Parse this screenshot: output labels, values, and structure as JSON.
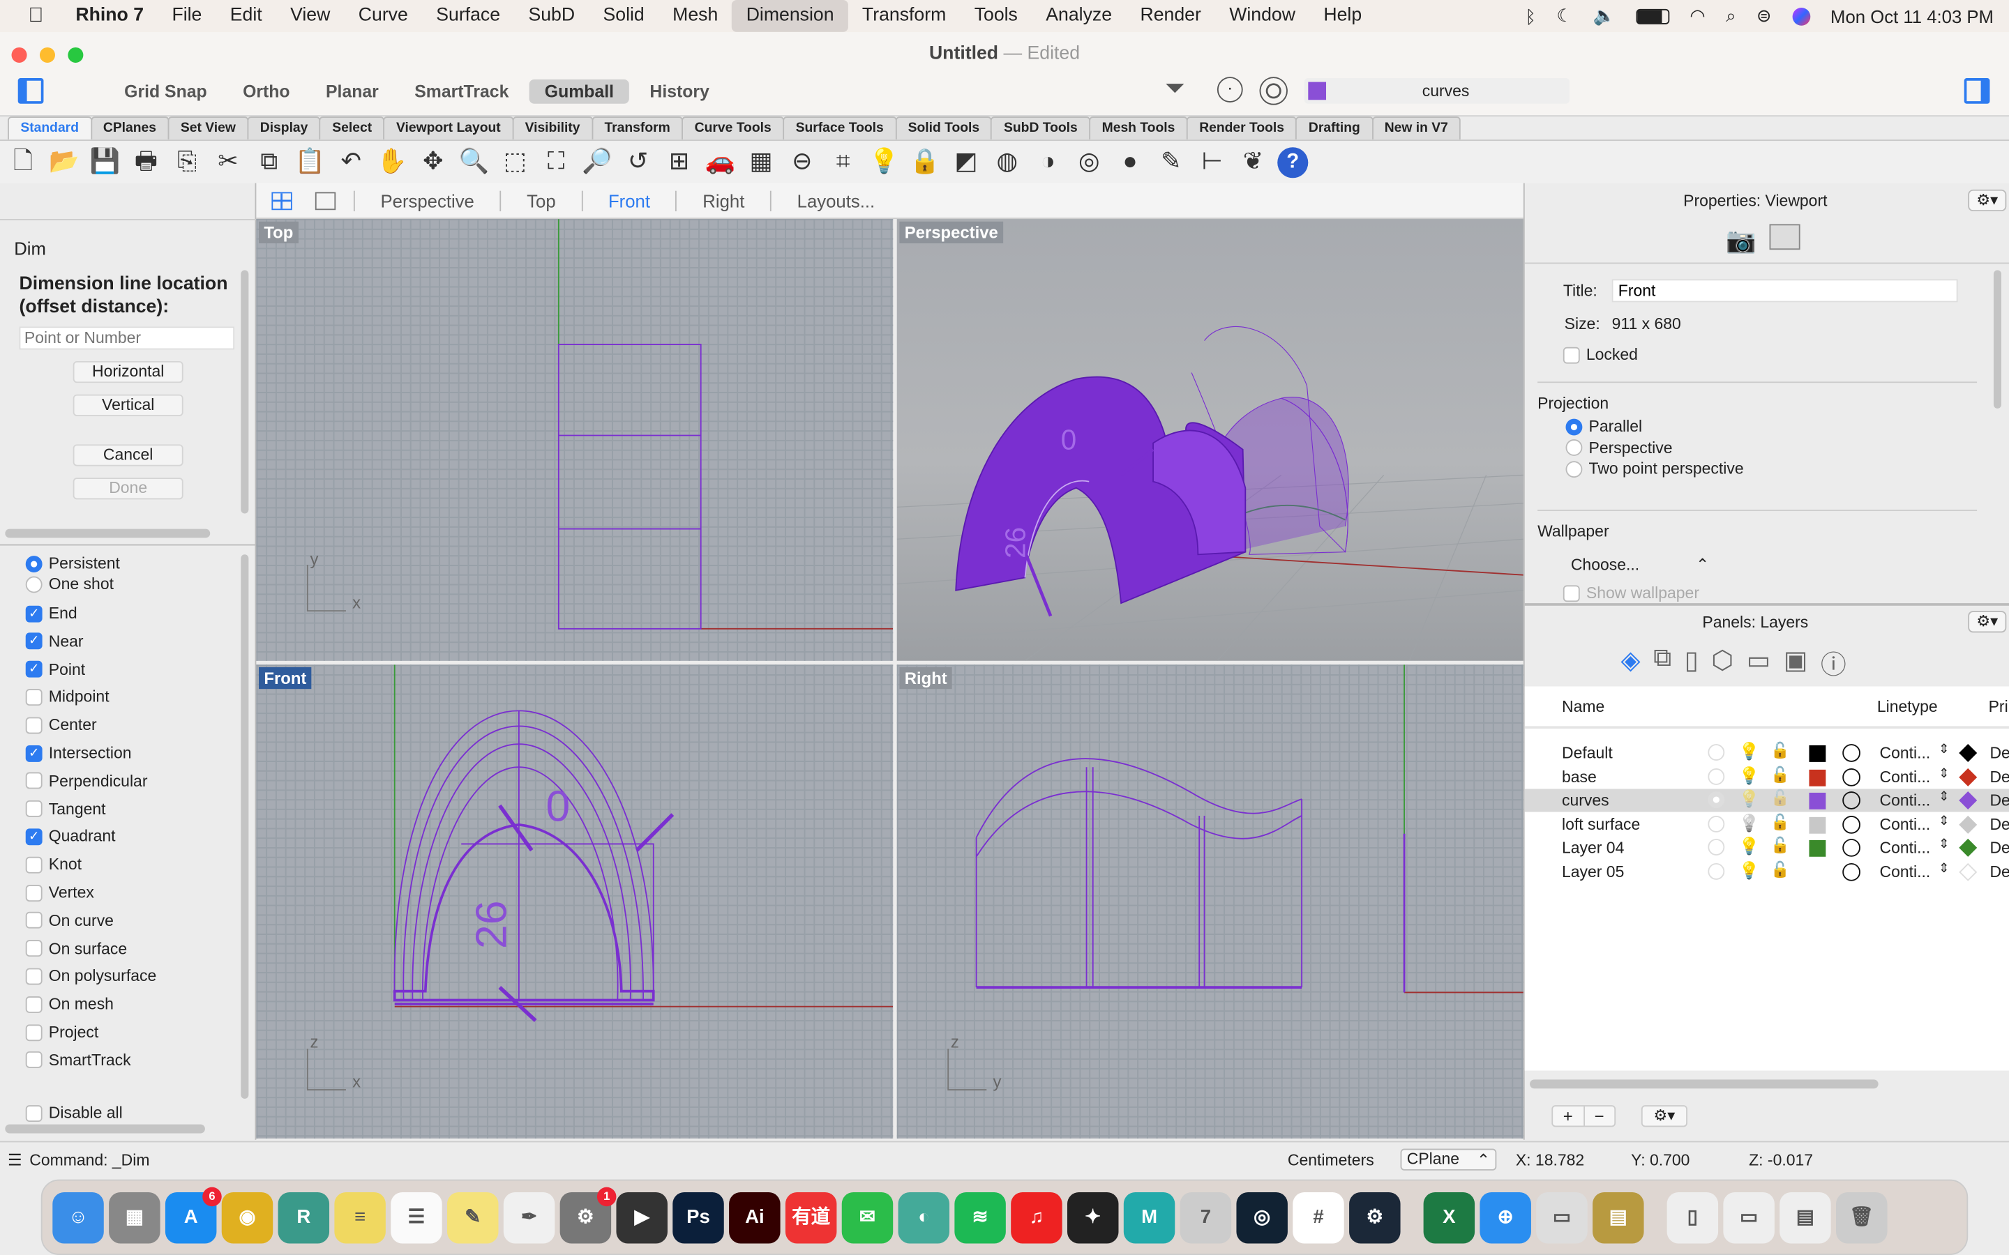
{
  "menubar": {
    "app": "Rhino 7",
    "items": [
      "File",
      "Edit",
      "View",
      "Curve",
      "Surface",
      "SubD",
      "Solid",
      "Mesh",
      "Dimension",
      "Transform",
      "Tools",
      "Analyze",
      "Render",
      "Window",
      "Help"
    ],
    "active": "Dimension",
    "clock": "Mon Oct 11  4:03 PM"
  },
  "window": {
    "title": "Untitled",
    "edited": "— Edited",
    "modes": [
      "Grid Snap",
      "Ortho",
      "Planar",
      "SmartTrack",
      "Gumball",
      "History"
    ],
    "active_mode": "Gumball",
    "current_layer": "curves",
    "layer_color": "#8a4fd6"
  },
  "toolbar_tabs": [
    "Standard",
    "CPlanes",
    "Set View",
    "Display",
    "Select",
    "Viewport Layout",
    "Visibility",
    "Transform",
    "Curve Tools",
    "Surface Tools",
    "Solid Tools",
    "SubD Tools",
    "Mesh Tools",
    "Render Tools",
    "Drafting",
    "New in V7"
  ],
  "toolbar_icons": [
    "new-icon",
    "open-icon",
    "save-icon",
    "print-icon",
    "import-icon",
    "cut-icon",
    "copy-icon",
    "paste-icon",
    "undo-icon",
    "pan-icon",
    "rotate-view-icon",
    "zoom-icon",
    "zoom-window-icon",
    "zoom-extents-icon",
    "zoom-selected-icon",
    "undo-view-icon",
    "four-viewports-icon",
    "car-icon",
    "mesh-icon",
    "osnap-icon",
    "cplane-icon",
    "light-icon",
    "lock-icon",
    "layer-icon",
    "color-wheel-icon",
    "shade-icon",
    "rendered-icon",
    "render-icon",
    "pencil-icon",
    "dimension-icon",
    "grasshopper-icon",
    "help-icon"
  ],
  "viewport_tabs": [
    "Perspective",
    "Top",
    "Front",
    "Right",
    "Layouts..."
  ],
  "active_viewport_tab": "Front",
  "command_panel": {
    "title": "Dim",
    "prompt": "Dimension line location (offset distance):",
    "input_placeholder": "Point or Number",
    "buttons": [
      "Horizontal",
      "Vertical",
      "Cancel",
      "Done"
    ]
  },
  "osnap": {
    "modes": [
      {
        "label": "Persistent",
        "on": true
      },
      {
        "label": "One shot",
        "on": false
      }
    ],
    "items": [
      {
        "label": "End",
        "on": true
      },
      {
        "label": "Near",
        "on": true
      },
      {
        "label": "Point",
        "on": true
      },
      {
        "label": "Midpoint",
        "on": false
      },
      {
        "label": "Center",
        "on": false
      },
      {
        "label": "Intersection",
        "on": true
      },
      {
        "label": "Perpendicular",
        "on": false
      },
      {
        "label": "Tangent",
        "on": false
      },
      {
        "label": "Quadrant",
        "on": true
      },
      {
        "label": "Knot",
        "on": false
      },
      {
        "label": "Vertex",
        "on": false
      },
      {
        "label": "On curve",
        "on": false
      },
      {
        "label": "On surface",
        "on": false
      },
      {
        "label": "On polysurface",
        "on": false
      },
      {
        "label": "On mesh",
        "on": false
      },
      {
        "label": "Project",
        "on": false
      },
      {
        "label": "SmartTrack",
        "on": false
      }
    ],
    "disable_all": "Disable all"
  },
  "viewports": {
    "top": "Top",
    "perspective": "Perspective",
    "front": "Front",
    "right": "Right",
    "dim_text_a": "0",
    "dim_text_b": "26",
    "axis": {
      "x": "x",
      "y": "y",
      "z": "z"
    }
  },
  "properties": {
    "header": "Properties: Viewport",
    "title_label": "Title:",
    "title_value": "Front",
    "size_label": "Size:",
    "size_value": "911 x 680",
    "locked": "Locked",
    "projection": "Projection",
    "projection_options": [
      {
        "label": "Parallel",
        "on": true
      },
      {
        "label": "Perspective",
        "on": false
      },
      {
        "label": "Two point perspective",
        "on": false
      }
    ],
    "wallpaper": "Wallpaper",
    "wallpaper_choose": "Choose...",
    "show_wallpaper": "Show wallpaper"
  },
  "layers": {
    "header": "Panels: Layers",
    "columns": {
      "name": "Name",
      "linetype": "Linetype",
      "print": "Pri"
    },
    "rows": [
      {
        "name": "Default",
        "color": "#000000",
        "linetype": "Conti...",
        "print": "De",
        "current": false,
        "on": true
      },
      {
        "name": "base",
        "color": "#c8321e",
        "linetype": "Conti...",
        "print": "De",
        "current": false,
        "on": true
      },
      {
        "name": "curves",
        "color": "#8a4fd6",
        "linetype": "Conti...",
        "print": "De",
        "current": true,
        "on": true
      },
      {
        "name": "loft surface",
        "color": "#c8c8c8",
        "linetype": "Conti...",
        "print": "De",
        "current": false,
        "on": false
      },
      {
        "name": "Layer 04",
        "color": "#3a8a2a",
        "linetype": "Conti...",
        "print": "De",
        "current": false,
        "on": true
      },
      {
        "name": "Layer 05",
        "color": "#ffffff",
        "linetype": "Conti...",
        "print": "De",
        "current": false,
        "on": true
      }
    ],
    "add": "+",
    "remove": "−"
  },
  "status": {
    "command": "Command: _Dim",
    "units": "Centimeters",
    "cplane": "CPlane",
    "x": "X: 18.782",
    "y": "Y: 0.700",
    "z": "Z: -0.017"
  },
  "dock": [
    {
      "name": "Finder",
      "c": "#3a8ee8",
      "t": "☺"
    },
    {
      "name": "Launchpad",
      "c": "#888",
      "t": "▦"
    },
    {
      "name": "App Store",
      "c": "#1a8cf0",
      "t": "A",
      "badge": "6"
    },
    {
      "name": "Chrome",
      "c": "#e0b020",
      "t": "◉"
    },
    {
      "name": "Rhino",
      "c": "#3a9a8a",
      "t": "R"
    },
    {
      "name": "Stickies",
      "c": "#f0d860",
      "t": "≡"
    },
    {
      "name": "Reminders",
      "c": "#fafafa",
      "t": "☰"
    },
    {
      "name": "Notes",
      "c": "#f5e27a",
      "t": "✎"
    },
    {
      "name": "TextEdit",
      "c": "#f0f0f0",
      "t": "✒"
    },
    {
      "name": "System Preferences",
      "c": "#777",
      "t": "⚙",
      "badge": "1"
    },
    {
      "name": "Final Cut",
      "c": "#333",
      "t": "▶"
    },
    {
      "name": "Photoshop",
      "c": "#0b1f3a",
      "t": "Ps"
    },
    {
      "name": "Illustrator",
      "c": "#330000",
      "t": "Ai"
    },
    {
      "name": "Youdao",
      "c": "#e33",
      "t": "有道"
    },
    {
      "name": "WeChat",
      "c": "#2bbd4a",
      "t": "✉"
    },
    {
      "name": "Maps",
      "c": "#4a9",
      "t": "◐"
    },
    {
      "name": "Spotify",
      "c": "#1db954",
      "t": "≋"
    },
    {
      "name": "NetEase Music",
      "c": "#e22",
      "t": "♫"
    },
    {
      "name": "Figma",
      "c": "#222",
      "t": "✦"
    },
    {
      "name": "Maya",
      "c": "#2aa",
      "t": "M"
    },
    {
      "name": "Rhino 7",
      "c": "#ccc",
      "t": "7"
    },
    {
      "name": "Cinema 4D",
      "c": "#123",
      "t": "◎"
    },
    {
      "name": "Slack",
      "c": "#fff",
      "t": "#"
    },
    {
      "name": "Steam",
      "c": "#1b2838",
      "t": "⚙"
    },
    {
      "name": "Excel",
      "c": "#1d7a43",
      "t": "X"
    },
    {
      "name": "Safari",
      "c": "#2a8ef0",
      "t": "⊕"
    },
    {
      "name": "Preview",
      "c": "#ddd",
      "t": "▭"
    },
    {
      "name": "Archive",
      "c": "#b89a40",
      "t": "▤"
    },
    {
      "name": "Documents",
      "c": "#eee",
      "t": "▯"
    },
    {
      "name": "Downloads",
      "c": "#eee",
      "t": "▭"
    },
    {
      "name": "Files",
      "c": "#eee",
      "t": "▤"
    },
    {
      "name": "Trash",
      "c": "#ccc",
      "t": "🗑"
    }
  ]
}
